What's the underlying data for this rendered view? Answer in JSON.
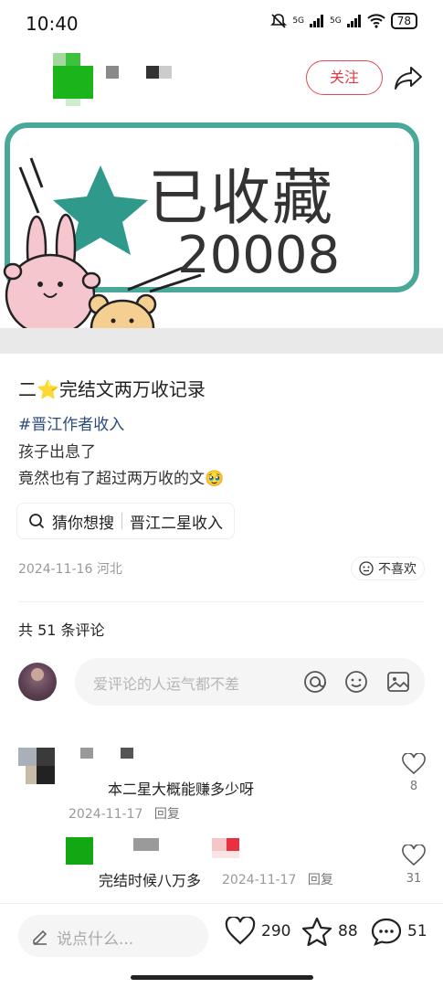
{
  "status": {
    "time": "10:40",
    "signal1": "5G",
    "signal2": "5G",
    "battery": "78"
  },
  "header": {
    "follow_label": "关注"
  },
  "banner": {
    "title": "已收藏",
    "count": "20008"
  },
  "post": {
    "title": "二⭐完结文两万收记录",
    "tag": "#晋江作者收入",
    "line1": "孩子出息了",
    "line2": "竟然也有了超过两万收的文🥹",
    "search_label": "猜你想搜",
    "search_term": "晋江二星收入",
    "date": "2024-11-16",
    "location": "河北",
    "dislike_label": "不喜欢"
  },
  "comments": {
    "count_label": "共 51 条评论",
    "input_placeholder": "爱评论的人运气都不差",
    "items": [
      {
        "text": "本二星大概能赚多少呀",
        "date": "2024-11-17",
        "reply": "回复",
        "likes": "8"
      },
      {
        "text": "完结时候八万多",
        "date": "2024-11-17",
        "reply": "回复",
        "likes": "31"
      }
    ]
  },
  "bottom": {
    "say_placeholder": "说点什么...",
    "likes": "290",
    "stars": "88",
    "comments": "51"
  },
  "colors": {
    "accent": "#e23a44",
    "banner_border": "#3d9a8a",
    "star": "#2f9a8b",
    "tag": "#2b4a7e"
  }
}
